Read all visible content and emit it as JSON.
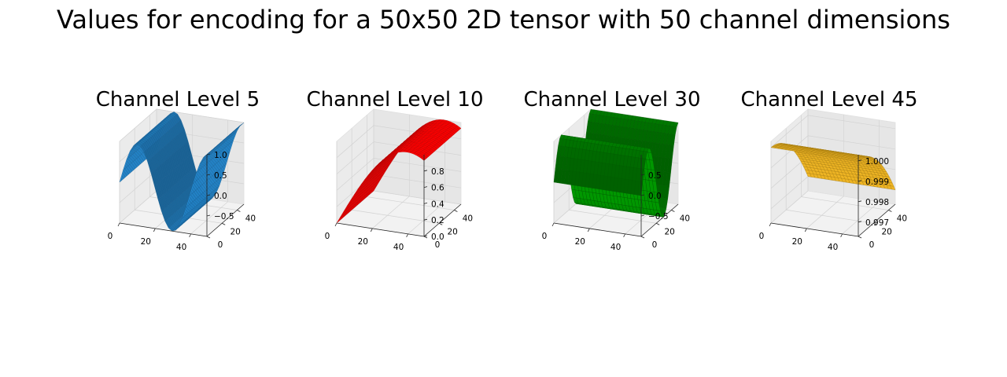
{
  "figure": {
    "title": "Values for encoding for a 50x50 2D tensor with 50 channel dimensions"
  },
  "chart_data": [
    {
      "type": "surface",
      "title": "Channel Level 5",
      "color": "#1f77b4",
      "edge_color": "#1a5f92",
      "x_range": [
        0,
        49
      ],
      "y_range": [
        0,
        49
      ],
      "x_ticks": [
        0,
        20,
        40
      ],
      "y_ticks": [
        0,
        20,
        40
      ],
      "z_ticks": [
        -0.5,
        0.0,
        0.5,
        1.0
      ],
      "z_tick_labels": [
        "−0.5",
        "0.0",
        "0.5",
        "1.0"
      ],
      "zlim": [
        -1.0,
        1.0
      ],
      "function": "sin",
      "frequency": 0.1585,
      "varies_along": "x"
    },
    {
      "type": "surface",
      "title": "Channel Level 10",
      "color": "#ff0000",
      "edge_color": "#b30000",
      "x_range": [
        0,
        49
      ],
      "y_range": [
        0,
        49
      ],
      "x_ticks": [
        0,
        20,
        40
      ],
      "y_ticks": [
        0,
        20,
        40
      ],
      "z_ticks": [
        0.0,
        0.2,
        0.4,
        0.6,
        0.8
      ],
      "z_tick_labels": [
        "0.0",
        "0.2",
        "0.4",
        "0.6",
        "0.8"
      ],
      "zlim": [
        0.0,
        1.0
      ],
      "function": "sin",
      "frequency": 0.0398,
      "varies_along": "x"
    },
    {
      "type": "surface",
      "title": "Channel Level 30",
      "color": "#008000",
      "edge_color": "#005c00",
      "x_range": [
        0,
        49
      ],
      "y_range": [
        0,
        49
      ],
      "x_ticks": [
        0,
        20,
        40
      ],
      "y_ticks": [
        0,
        20,
        40
      ],
      "z_ticks": [
        -0.5,
        0.0,
        0.5
      ],
      "z_tick_labels": [
        "−0.5",
        "0.0",
        "0.5"
      ],
      "zlim": [
        -1.0,
        1.0
      ],
      "function": "sin",
      "frequency": 0.1585,
      "varies_along": "y"
    },
    {
      "type": "surface",
      "title": "Channel Level 45",
      "color": "#daa520",
      "edge_color": "#a67c10",
      "x_range": [
        0,
        49
      ],
      "y_range": [
        0,
        49
      ],
      "x_ticks": [
        0,
        20,
        40
      ],
      "y_ticks": [
        0,
        20,
        40
      ],
      "z_ticks": [
        0.997,
        0.998,
        0.999,
        1.0
      ],
      "z_tick_labels": [
        "0.997",
        "0.998",
        "0.999",
        "1.000"
      ],
      "zlim": [
        0.9963,
        1.0003
      ],
      "function": "cos",
      "frequency": 0.00158,
      "varies_along": "y"
    }
  ]
}
